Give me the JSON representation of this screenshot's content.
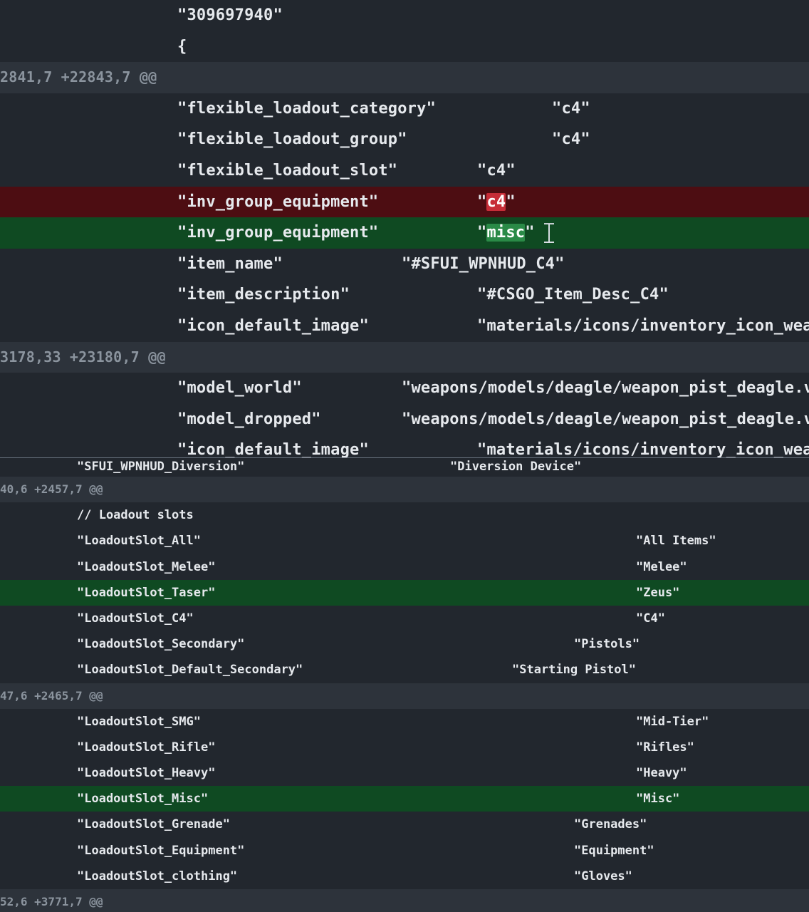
{
  "top_panel": {
    "rows": [
      {
        "type": "context",
        "key": "\"309697940\"",
        "value": ""
      },
      {
        "type": "context",
        "key": "{",
        "value": ""
      },
      {
        "type": "hunk",
        "header": "2841,7 +22843,7 @@"
      },
      {
        "type": "context",
        "key": "\"flexible_loadout_category\"",
        "value": "\"c4\""
      },
      {
        "type": "context",
        "key": "\"flexible_loadout_group\"",
        "value": "\"c4\""
      },
      {
        "type": "context",
        "key": "\"flexible_loadout_slot\"",
        "value": "\"c4\""
      },
      {
        "type": "deletion",
        "key": "\"inv_group_equipment\"",
        "value_pre": "\"",
        "value_hl": "c4",
        "value_post": "\""
      },
      {
        "type": "addition",
        "key": "\"inv_group_equipment\"",
        "value_pre": "\"",
        "value_hl": "misc",
        "value_post": "\""
      },
      {
        "type": "context",
        "key": "\"item_name\"",
        "value": "\"#SFUI_WPNHUD_C4\""
      },
      {
        "type": "context",
        "key": "\"item_description\"",
        "value": "\"#CSGO_Item_Desc_C4\""
      },
      {
        "type": "context",
        "key": "\"icon_default_image\"",
        "value": "\"materials/icons/inventory_icon_weap"
      },
      {
        "type": "hunk",
        "header": "3178,33 +23180,7 @@"
      },
      {
        "type": "context",
        "key": "\"model_world\"",
        "value": "\"weapons/models/deagle/weapon_pist_deagle.vm"
      },
      {
        "type": "context",
        "key": "\"model_dropped\"",
        "value": "\"weapons/models/deagle/weapon_pist_deagle.vm"
      },
      {
        "type": "context",
        "key": "\"icon_default_image\"",
        "value": "\"materials/icons/inventory_icon_weap"
      }
    ]
  },
  "bottom_panel": {
    "rows": [
      {
        "type": "context",
        "key": "\"SFUI_WPNHUD_Diversion\"",
        "value": "\"Diversion Device\""
      },
      {
        "type": "hunk",
        "header": "40,6 +2457,7 @@"
      },
      {
        "type": "context",
        "key": "// Loadout slots",
        "value": ""
      },
      {
        "type": "context",
        "key": "\"LoadoutSlot_All\"",
        "value": "\"All Items\""
      },
      {
        "type": "context",
        "key": "\"LoadoutSlot_Melee\"",
        "value": "\"Melee\""
      },
      {
        "type": "addition",
        "key": "\"LoadoutSlot_Taser\"",
        "value": "\"Zeus\""
      },
      {
        "type": "context",
        "key": "\"LoadoutSlot_C4\"",
        "value": "\"C4\""
      },
      {
        "type": "context",
        "key": "\"LoadoutSlot_Secondary\"",
        "value": "\"Pistols\""
      },
      {
        "type": "context",
        "key": "\"LoadoutSlot_Default_Secondary\"",
        "value": "\"Starting Pistol\""
      },
      {
        "type": "hunk",
        "header": "47,6 +2465,7 @@"
      },
      {
        "type": "context",
        "key": "\"LoadoutSlot_SMG\"",
        "value": "\"Mid-Tier\""
      },
      {
        "type": "context",
        "key": "\"LoadoutSlot_Rifle\"",
        "value": "\"Rifles\""
      },
      {
        "type": "context",
        "key": "\"LoadoutSlot_Heavy\"",
        "value": "\"Heavy\""
      },
      {
        "type": "addition",
        "key": "\"LoadoutSlot_Misc\"",
        "value": "\"Misc\""
      },
      {
        "type": "context",
        "key": "\"LoadoutSlot_Grenade\"",
        "value": "\"Grenades\""
      },
      {
        "type": "context",
        "key": "\"LoadoutSlot_Equipment\"",
        "value": "\"Equipment\""
      },
      {
        "type": "context",
        "key": "\"LoadoutSlot_clothing\"",
        "value": "\"Gloves\""
      },
      {
        "type": "hunk",
        "header": "52,6 +3771,7 @@"
      }
    ]
  },
  "cursor": {
    "icon": "text-cursor-icon"
  },
  "colors": {
    "background": "#22272e",
    "hunk_background": "#2d333b",
    "deletion_background": "#4d0d12",
    "addition_background": "#0f4a22",
    "deletion_highlight": "#c72d38",
    "addition_highlight": "#2a8a47"
  }
}
